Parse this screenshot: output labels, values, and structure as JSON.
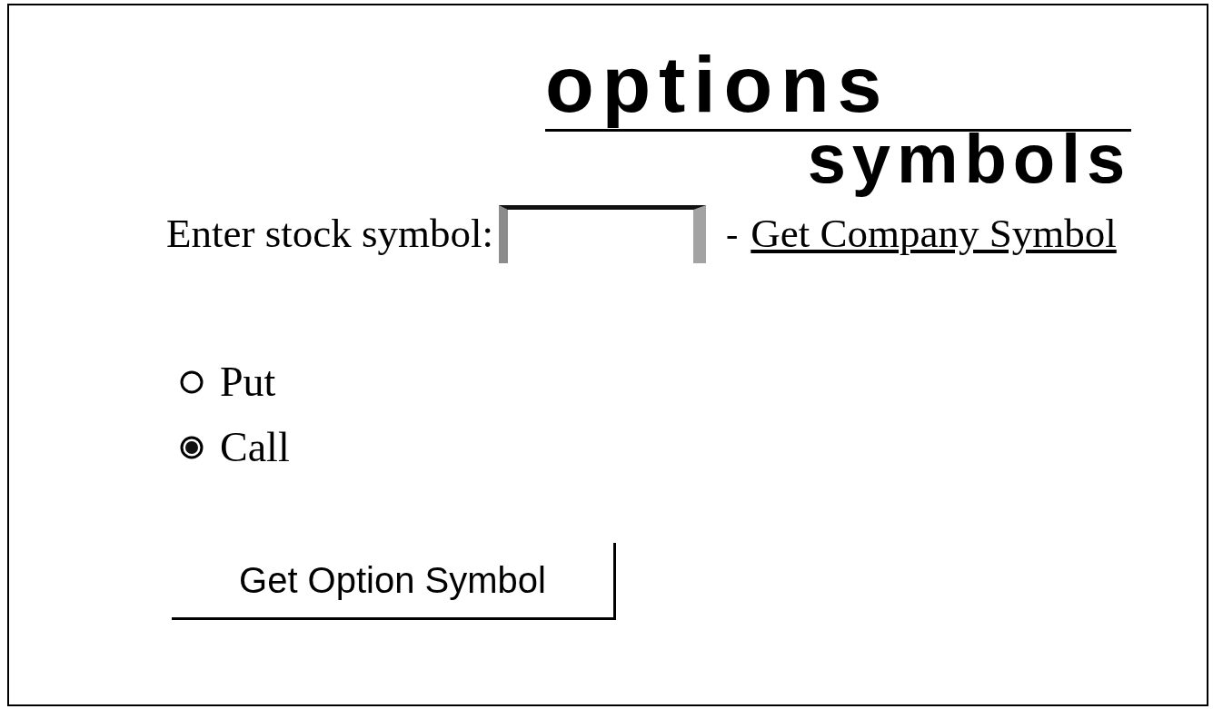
{
  "header": {
    "title": "options",
    "subtitle": "symbols"
  },
  "stock_symbol": {
    "label": "Enter stock symbol:",
    "separator": "-",
    "link": "Get Company Symbol"
  },
  "option_types": [
    {
      "label": "Put",
      "selected": false
    },
    {
      "label": "Call",
      "selected": true
    }
  ],
  "buttons": [
    "Get Option Symbol"
  ]
}
